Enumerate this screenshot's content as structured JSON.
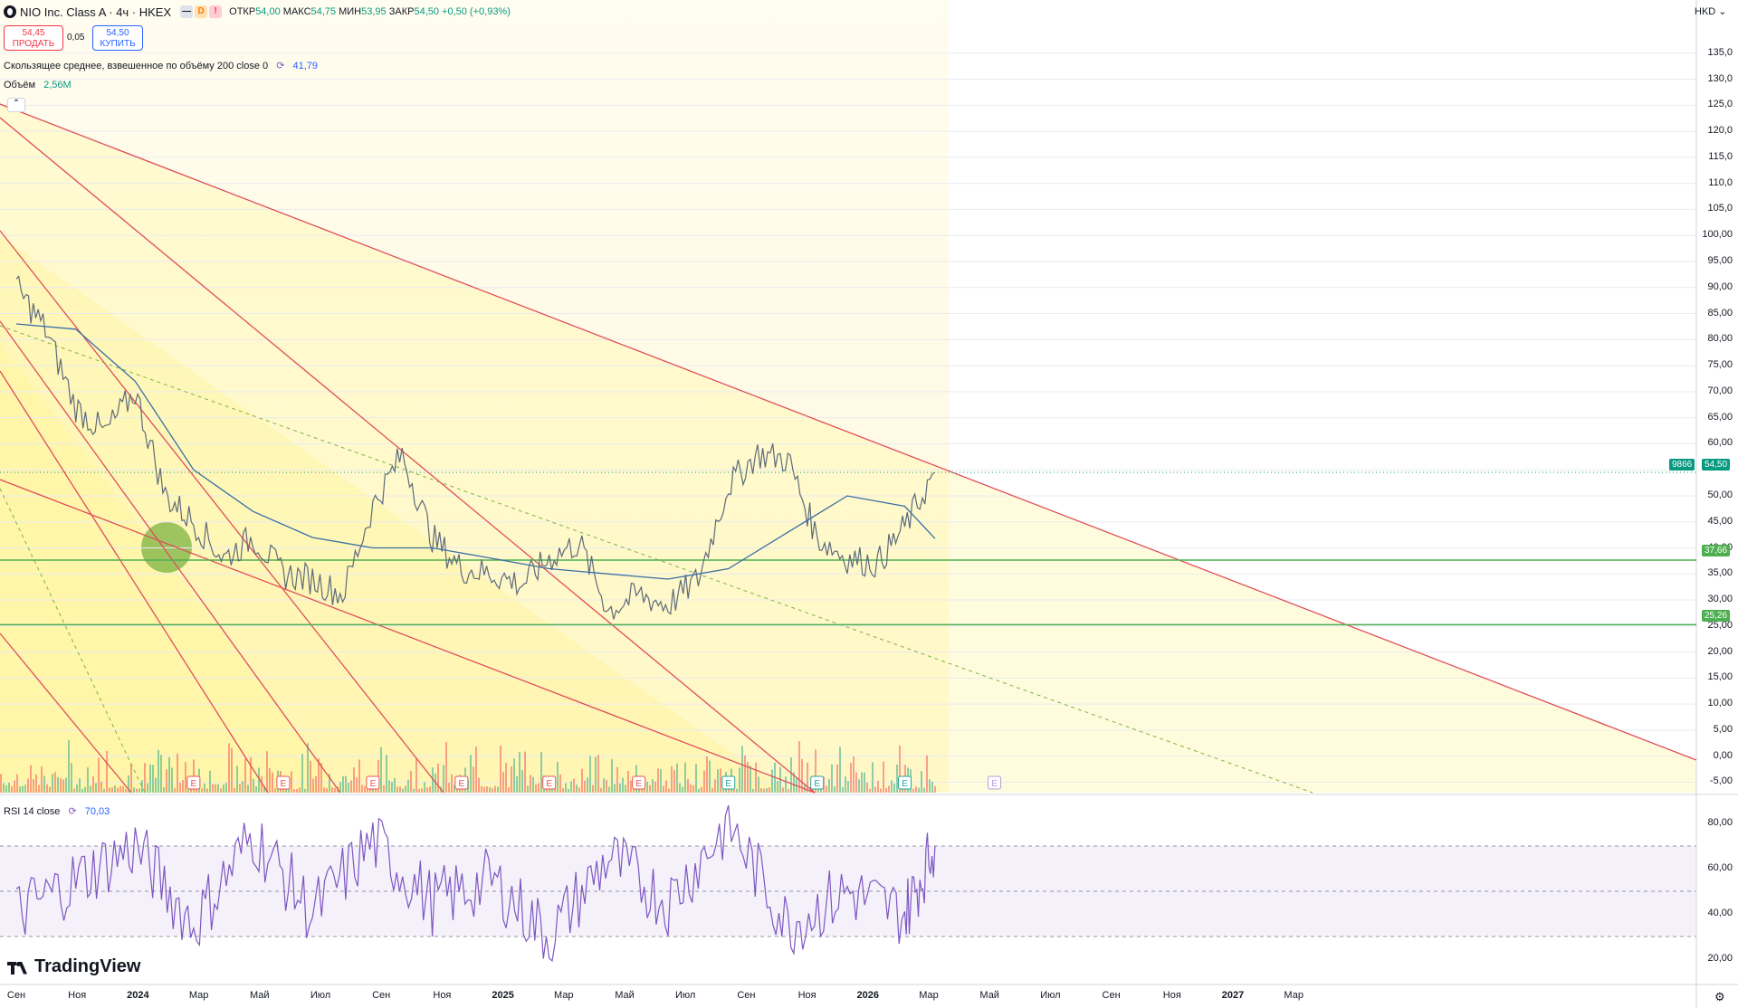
{
  "header": {
    "title": "NIO Inc. Class A · 4ч · HKEX",
    "badges": [
      "—",
      "D",
      "!"
    ],
    "ohlc": {
      "open_label": "ОТКР",
      "open": "54,00",
      "high_label": "МАКС",
      "high": "54,75",
      "low_label": "МИН",
      "low": "53,95",
      "close_label": "ЗАКР",
      "close": "54,50",
      "change": "+0,50 (+0,93%)"
    }
  },
  "trade": {
    "sell_price": "54,45",
    "sell_label": "ПРОДАТЬ",
    "spread": "0,05",
    "buy_price": "54,50",
    "buy_label": "КУПИТЬ"
  },
  "indicators": {
    "vwma": {
      "label": "Скользящее среднее, взвешенное по объёму 200 close 0",
      "value": "41,79"
    },
    "volume": {
      "label": "Объём",
      "value": "2,56M"
    },
    "rsi": {
      "label": "RSI 14 close",
      "value": "70,03"
    }
  },
  "price_axis": {
    "currency": "HKD",
    "ticks": [
      "135,0",
      "130,0",
      "125,0",
      "120,0",
      "115,0",
      "110,0",
      "105,0",
      "100,00",
      "95,00",
      "90,00",
      "85,00",
      "80,00",
      "75,00",
      "70,00",
      "65,00",
      "60,00",
      "50,00",
      "45,00",
      "40,00",
      "35,00",
      "30,00",
      "25,00",
      "20,00",
      "15,00",
      "10,00",
      "5,00",
      "0,00",
      "-5,00"
    ],
    "last_price": "54,50",
    "last_price_prefix": "9866",
    "level_1": "37,66",
    "level_2": "25,26"
  },
  "rsi_axis": {
    "ticks": [
      "80,00",
      "60,00",
      "40,00",
      "20,00"
    ]
  },
  "time_axis": {
    "labels": [
      "Сен",
      "Ноя",
      "2024",
      "Мар",
      "Май",
      "Июл",
      "Сен",
      "Ноя",
      "2025",
      "Мар",
      "Май",
      "Июл",
      "Сен",
      "Ноя",
      "2026",
      "Мар",
      "Май",
      "Июл",
      "Сен",
      "Ноя",
      "2027",
      "Мар"
    ],
    "bold_labels": [
      "2024",
      "2025",
      "2026",
      "2027"
    ]
  },
  "earnings_marker": "E",
  "brand": "TradingView",
  "colors": {
    "up": "#089981",
    "down": "#f23645",
    "trendline": "#e04e5b",
    "level": "#4caf50",
    "vwma": "#3a6ea5",
    "rsi": "#7e57c2",
    "fill": "#fff59d"
  },
  "chart_data": {
    "type": "line",
    "title": "NIO Inc. Class A · 4ч · HKEX",
    "series": [
      {
        "name": "Price",
        "x": [
          "2023-09",
          "2023-10",
          "2023-11",
          "2023-12",
          "2024-01",
          "2024-02",
          "2024-03",
          "2024-04",
          "2024-05",
          "2024-06",
          "2024-07",
          "2024-08",
          "2024-09",
          "2024-10",
          "2024-11",
          "2024-12",
          "2025-01",
          "2025-02",
          "2025-03",
          "2025-04",
          "2025-05",
          "2025-06",
          "2025-07",
          "2025-08",
          "2025-09",
          "2025-10",
          "2025-11",
          "2025-12",
          "2026-01",
          "2026-02",
          "2026-03",
          "2026-04"
        ],
        "values": [
          90,
          82,
          67,
          62,
          70,
          50,
          45,
          38,
          42,
          35,
          34,
          31,
          48,
          58,
          42,
          36,
          35,
          33,
          38,
          41,
          28,
          31,
          29,
          34,
          52,
          58,
          57,
          42,
          38,
          37,
          44,
          54.5
        ]
      },
      {
        "name": "VWMA 200",
        "x": [
          "2023-09",
          "2023-11",
          "2024-01",
          "2024-03",
          "2024-05",
          "2024-07",
          "2024-09",
          "2024-11",
          "2025-01",
          "2025-03",
          "2025-05",
          "2025-07",
          "2025-09",
          "2025-11",
          "2026-01",
          "2026-03",
          "2026-04"
        ],
        "values": [
          83,
          82,
          72,
          55,
          47,
          42,
          40,
          40,
          38,
          36,
          35,
          34,
          36,
          43,
          50,
          48,
          41.79
        ]
      },
      {
        "name": "RSI 14",
        "x": [
          "2023-09",
          "2023-11",
          "2024-01",
          "2024-03",
          "2024-05",
          "2024-07",
          "2024-09",
          "2024-11",
          "2025-01",
          "2025-03",
          "2025-05",
          "2025-07",
          "2025-09",
          "2025-11",
          "2026-01",
          "2026-03",
          "2026-04"
        ],
        "values": [
          40,
          55,
          70,
          35,
          75,
          40,
          72,
          45,
          55,
          30,
          65,
          45,
          80,
          35,
          50,
          40,
          70.03
        ]
      }
    ],
    "ylim": [
      -7,
      140
    ],
    "rsi_ylim": [
      10,
      92
    ],
    "levels": [
      37.66,
      25.26
    ],
    "xlabel": "",
    "ylabel": ""
  }
}
